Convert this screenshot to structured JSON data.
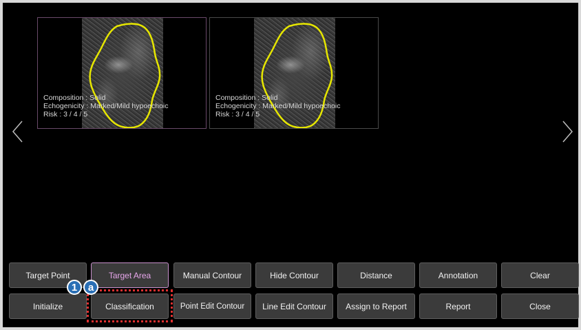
{
  "images": [
    {
      "composition": "Composition : Solid",
      "echogenicity": "Echogenicity : Marked/Mild hypoechoic",
      "risk": "Risk : 3 / 4 / 5"
    },
    {
      "composition": "Composition : Solid",
      "echogenicity": "Echogenicity : Marked/Mild hypoechoic",
      "risk": "Risk : 3 / 4 / 5"
    }
  ],
  "toolbar": {
    "row1": [
      "Target Point",
      "Target Area",
      "Manual Contour",
      "Hide Contour",
      "Distance",
      "Annotation",
      "Clear"
    ],
    "row2": [
      "Initialize",
      "Classification",
      "Point Edit Contour",
      "Line Edit Contour",
      "Assign to Report",
      "Report",
      "Close"
    ],
    "active": "Target Area"
  },
  "callouts": {
    "step": "1",
    "sub": "a"
  },
  "colors": {
    "contour": "#e6e600",
    "active_text": "#e6a6ea",
    "badge": "#2a6fb5",
    "highlight": "#e03030"
  },
  "icons": {
    "prev": "chevron-left-icon",
    "next": "chevron-right-icon"
  }
}
